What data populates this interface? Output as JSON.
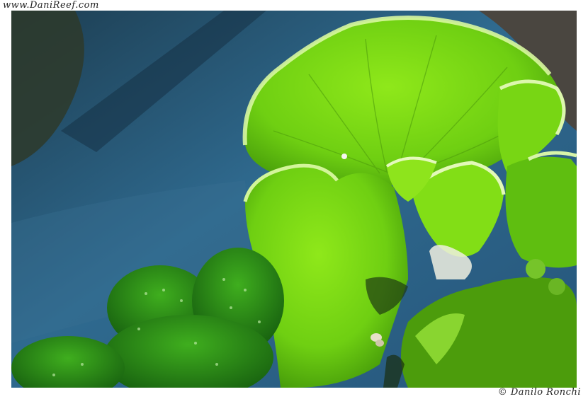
{
  "watermark_top": "www.DaniReef.com",
  "watermark_bottom": "© Danilo Ronchi",
  "photo": {
    "subject": "green-montipora-coral",
    "colors": {
      "coral": "#7fe010",
      "coral_dark": "#3f9a08",
      "coral_light": "#c6f27a",
      "background": "#2b5a7a",
      "rock": "#3c3a2e"
    }
  }
}
